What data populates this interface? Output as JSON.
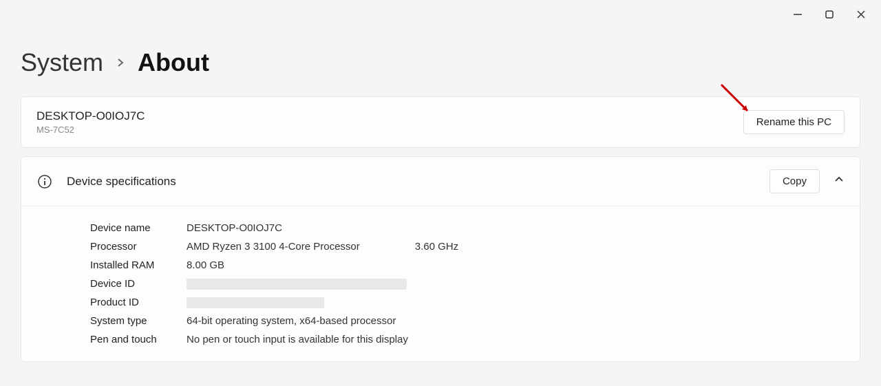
{
  "breadcrumb": {
    "parent": "System",
    "current": "About"
  },
  "device": {
    "name": "DESKTOP-O0IOJ7C",
    "model": "MS-7C52",
    "rename_btn": "Rename this PC"
  },
  "specs": {
    "section_title": "Device specifications",
    "copy_btn": "Copy",
    "rows": {
      "device_name_label": "Device name",
      "device_name_value": "DESKTOP-O0IOJ7C",
      "processor_label": "Processor",
      "processor_value": "AMD Ryzen 3 3100 4-Core Processor",
      "processor_speed": "3.60 GHz",
      "ram_label": "Installed RAM",
      "ram_value": "8.00 GB",
      "device_id_label": "Device ID",
      "product_id_label": "Product ID",
      "system_type_label": "System type",
      "system_type_value": "64-bit operating system, x64-based processor",
      "pen_touch_label": "Pen and touch",
      "pen_touch_value": "No pen or touch input is available for this display"
    }
  }
}
